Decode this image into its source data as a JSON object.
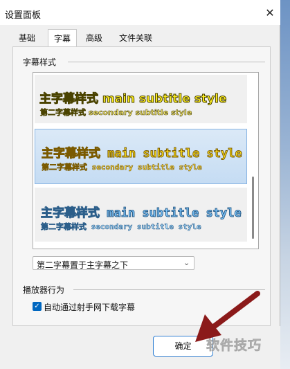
{
  "window": {
    "title": "设置面板",
    "close_glyph": "✕"
  },
  "tabs": [
    {
      "label": "基础",
      "active": false
    },
    {
      "label": "字幕",
      "active": true
    },
    {
      "label": "高级",
      "active": false
    },
    {
      "label": "文件关联",
      "active": false
    }
  ],
  "subtitle_style": {
    "group_label": "字幕样式",
    "styles": [
      {
        "main": "主字幕样式 main subtitle style",
        "secondary": "第二字幕样式 secondary subtitle style",
        "selected": false
      },
      {
        "main": "主字幕样式 main subtitle style",
        "secondary": "第二字幕样式 secondary subtitle style",
        "selected": true
      },
      {
        "main": "主字幕样式 main subtitle style",
        "secondary": "第二字幕样式 secondary subtitle style",
        "selected": false
      }
    ],
    "position_select": {
      "value": "第二字幕置于主字幕之下",
      "arrow_glyph": "⌄"
    }
  },
  "player_behavior": {
    "group_label": "播放器行为",
    "auto_download": {
      "label": "自动通过射手网下载字幕",
      "checked": true,
      "check_glyph": "✓"
    }
  },
  "footer": {
    "ok_label": "确定"
  },
  "watermark": {
    "text": "软件技巧"
  },
  "colors": {
    "accent": "#0067c0",
    "annotation_arrow": "#8b1a1a"
  }
}
